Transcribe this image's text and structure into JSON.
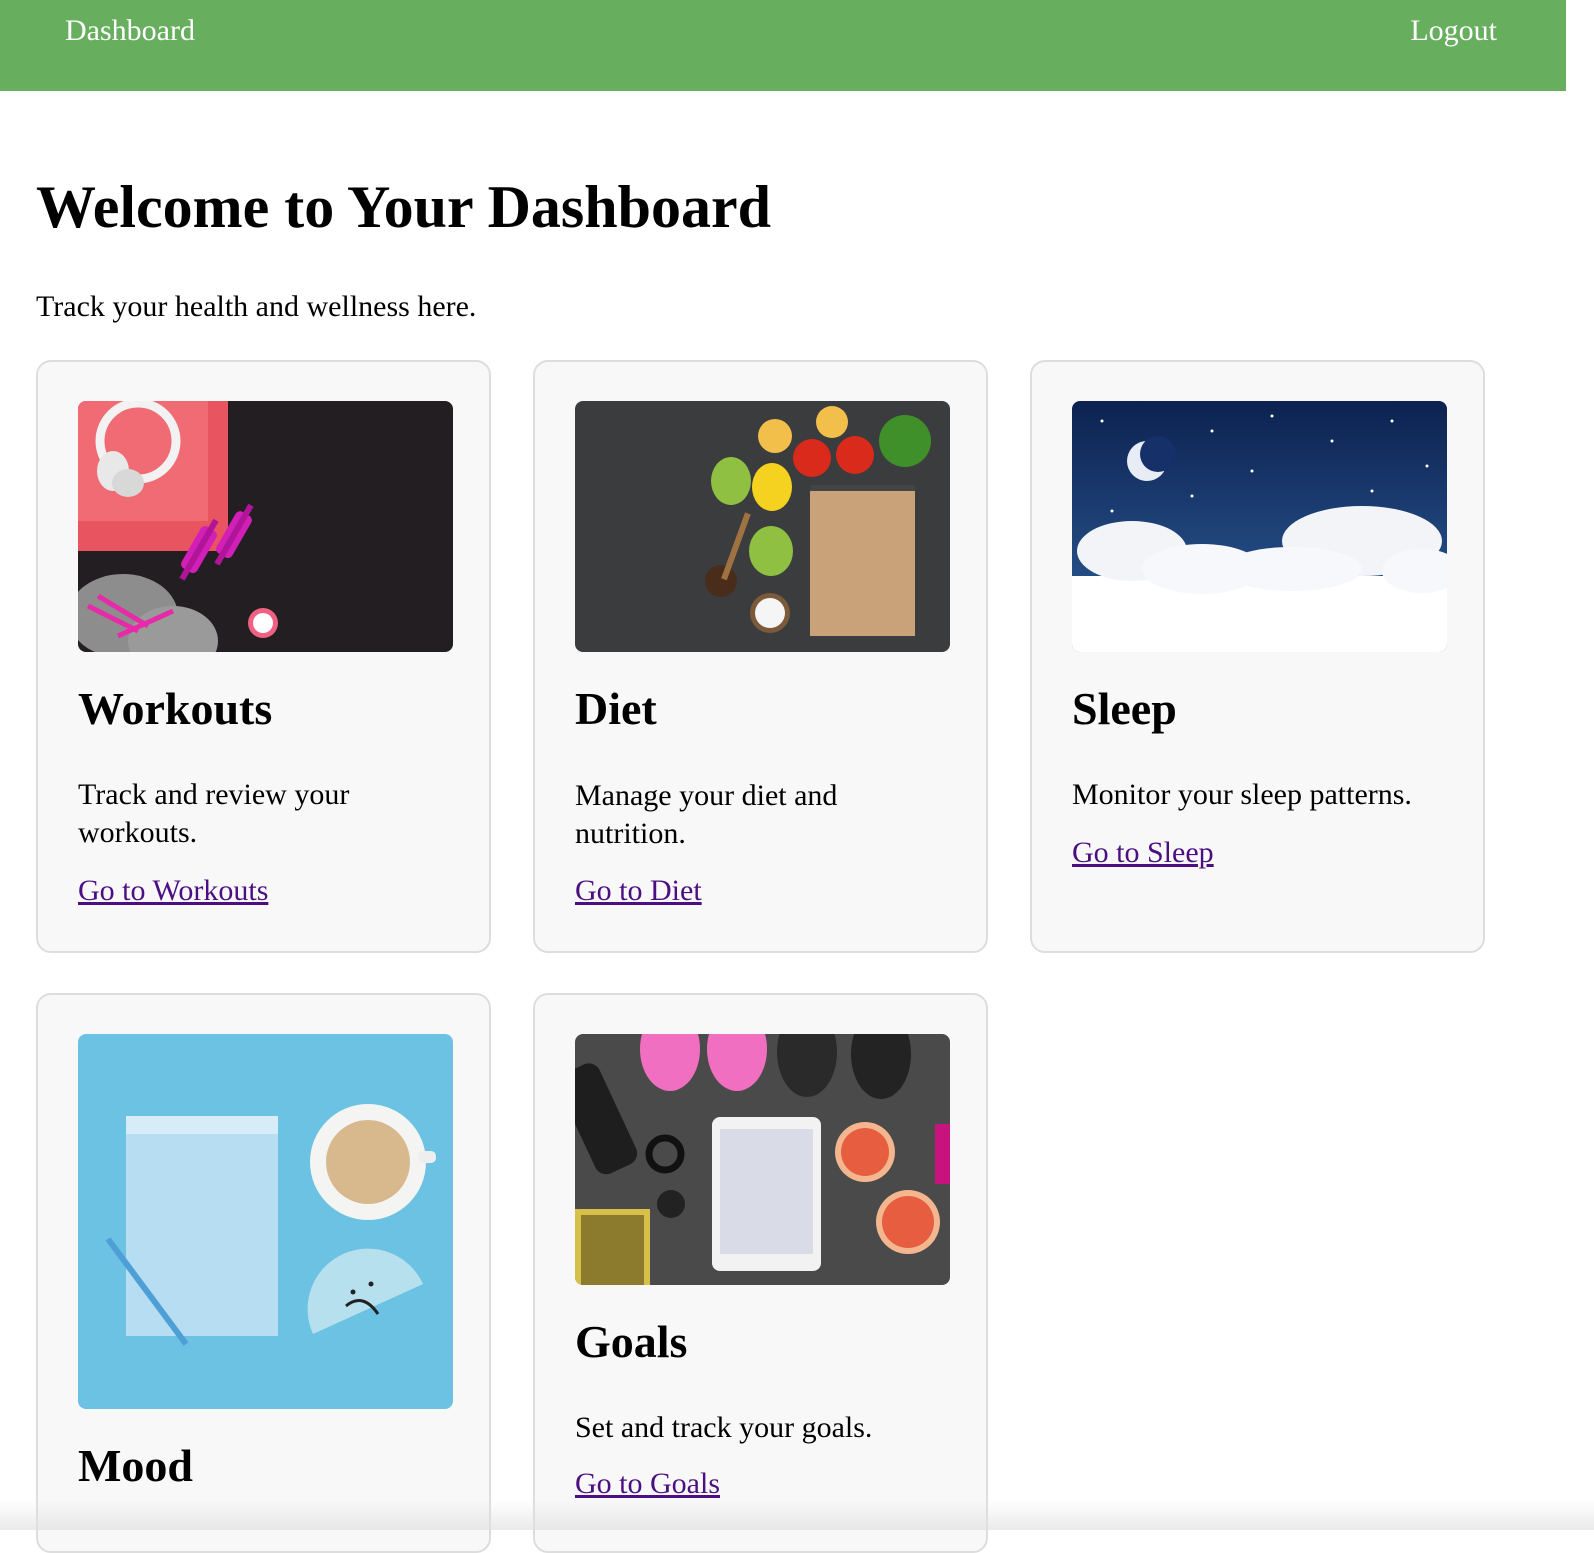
{
  "nav": {
    "home_label": "Dashboard",
    "logout_label": "Logout"
  },
  "header": {
    "title": "Welcome to Your Dashboard",
    "subtitle": "Track your health and wellness here."
  },
  "cards": [
    {
      "title": "Workouts",
      "description": "Track and review your workouts.",
      "link": "Go to Workouts",
      "image": "workout-gear-image"
    },
    {
      "title": "Diet",
      "description": "Manage your diet and nutrition.",
      "link": "Go to Diet",
      "image": "vegetables-notepad-image"
    },
    {
      "title": "Sleep",
      "description": "Monitor your sleep patterns.",
      "link": "Go to Sleep",
      "image": "night-sky-moon-image"
    },
    {
      "title": "Mood",
      "description": "",
      "link": "",
      "image": "notebook-coffee-sad-face-image"
    },
    {
      "title": "Goals",
      "description": "Set and track your goals.",
      "link": "Go to Goals",
      "image": "sneakers-tablet-grapefruit-image"
    }
  ],
  "colors": {
    "header_bg": "#68ae5f",
    "card_bg": "#f8f8f9",
    "card_border": "#dddddd",
    "link": "#4b0f82"
  }
}
